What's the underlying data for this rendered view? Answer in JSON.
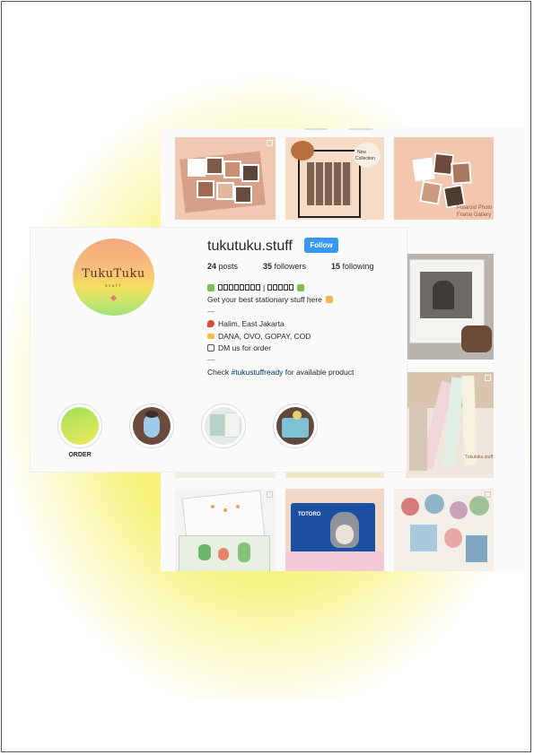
{
  "profile": {
    "username": "tukutuku.stuff",
    "follow_label": "Follow",
    "stats": {
      "posts": "24",
      "posts_label": "posts",
      "followers": "35",
      "followers_label": "followers",
      "following": "15",
      "following_label": "following"
    },
    "avatar_logo": {
      "title": "TukuTuku",
      "subtitle": "stuff"
    },
    "bio": {
      "line1_text": "Get your best stationary stuff here",
      "location": "Halim, East Jakarta",
      "payment": "DANA, OVO, GOPAY, COD",
      "dm": "DM us for order",
      "check_prefix": "Check ",
      "hashtag": "#tukustuffready",
      "check_suffix": " for available product"
    },
    "highlights": [
      {
        "label": "ORDER"
      },
      {
        "label": ""
      },
      {
        "label": ""
      },
      {
        "label": ""
      }
    ]
  },
  "posts": {
    "tile2_labels": [
      "New",
      "Collection"
    ],
    "tile3_labels": [
      "Polaroid Photo",
      "Frame Gallery"
    ],
    "tile8_label": "Tukutuku stuff",
    "tile11_label": "TOTORO"
  },
  "colors": {
    "follow_button": "#3897f0",
    "hashtag": "#003569",
    "glow": "#f6f26a",
    "avatar_top": "#f5a67f",
    "avatar_bottom": "#9fe07b"
  }
}
